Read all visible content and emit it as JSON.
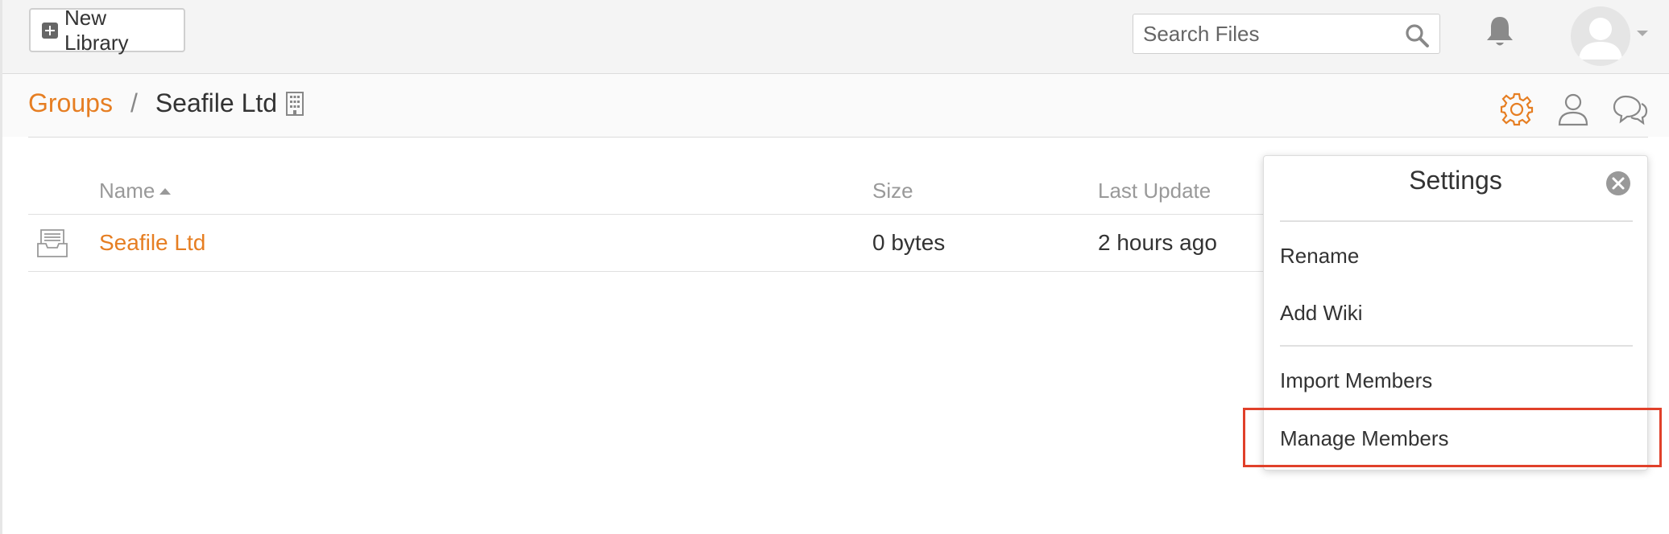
{
  "header": {
    "new_library_label": "New Library",
    "search_placeholder": "Search Files"
  },
  "breadcrumb": {
    "groups": "Groups",
    "separator": "/",
    "current": "Seafile Ltd"
  },
  "table": {
    "columns": {
      "name": "Name",
      "size": "Size",
      "last_update": "Last Update"
    },
    "rows": [
      {
        "name": "Seafile Ltd",
        "size": "0 bytes",
        "last_update": "2 hours ago"
      }
    ]
  },
  "settings_popover": {
    "title": "Settings",
    "items": [
      "Rename",
      "Add Wiki",
      "Import Members",
      "Manage Members"
    ],
    "highlighted_item": "Manage Members"
  },
  "colors": {
    "accent": "#e67e22",
    "highlight_box": "#e0402a"
  }
}
